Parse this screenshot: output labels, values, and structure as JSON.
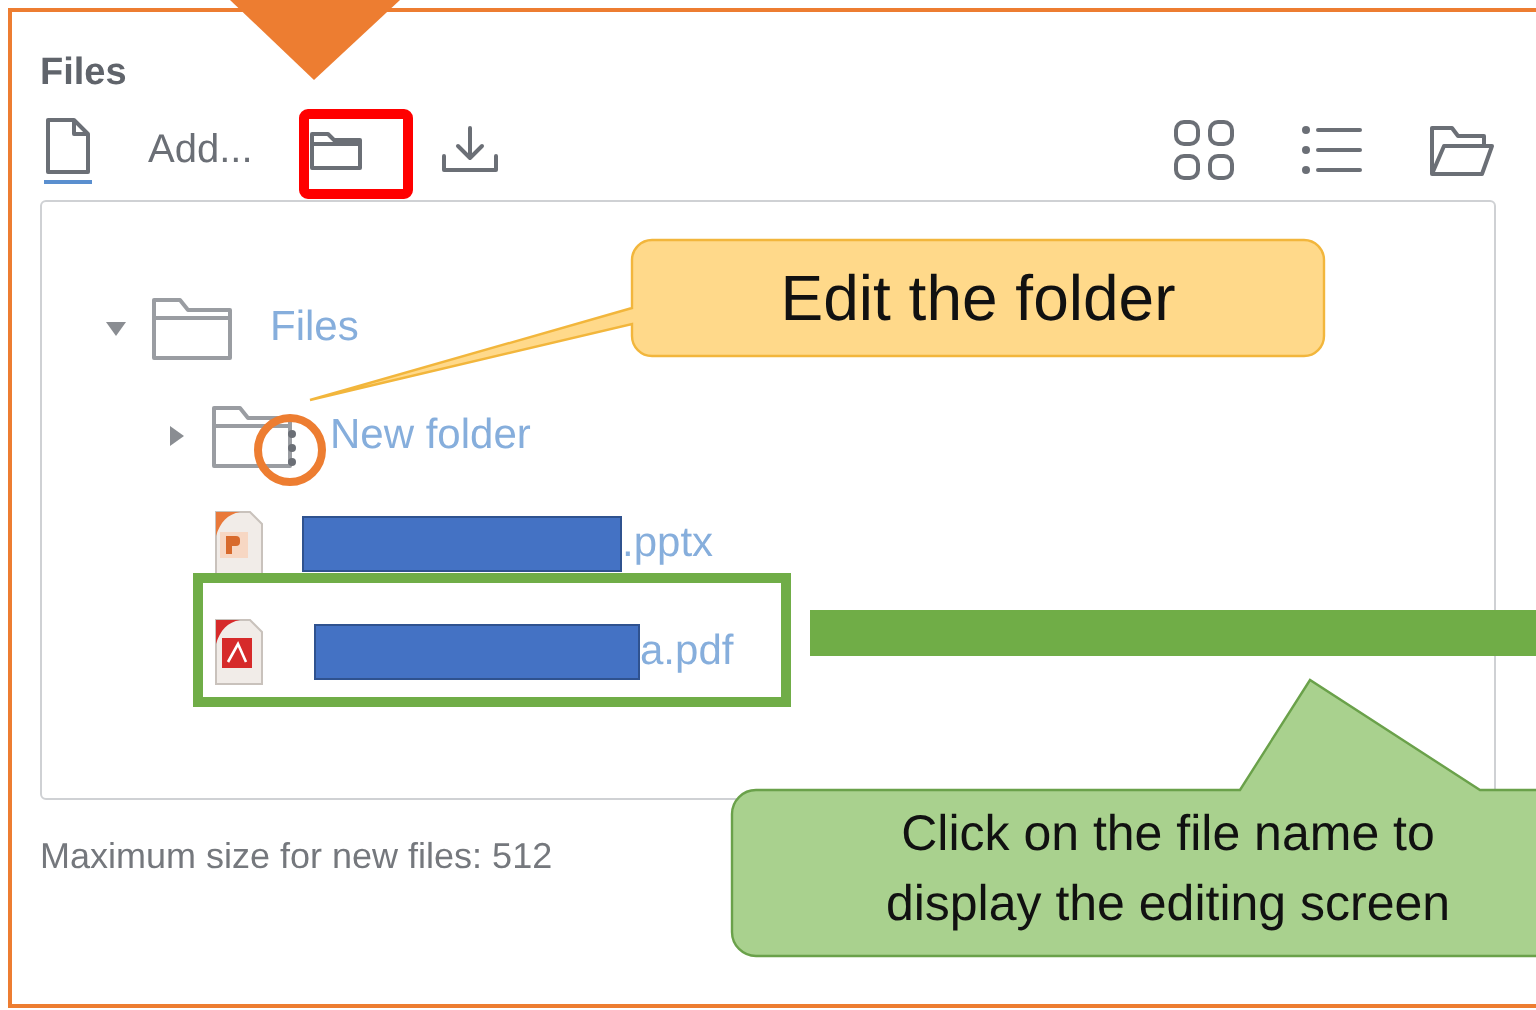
{
  "panel": {
    "title": "Files"
  },
  "toolbar": [
    {
      "kind": "add-file",
      "label": "Add...",
      "selected": true
    },
    {
      "kind": "new-folder",
      "selected": false
    },
    {
      "kind": "download",
      "selected": false
    }
  ],
  "view_buttons": [
    {
      "kind": "grid"
    },
    {
      "kind": "list"
    },
    {
      "kind": "folder"
    }
  ],
  "tree": [
    {
      "kind": "folder",
      "name": "Files",
      "expanded": true,
      "children": [
        {
          "kind": "folder",
          "name": "New folder",
          "expanded": false
        },
        {
          "kind": "pptx",
          "name": ".pptx",
          "redacted": true
        },
        {
          "kind": "pdf",
          "name": "a.pdf",
          "redacted": true
        }
      ]
    }
  ],
  "footer": "Maximum size for new files: 512",
  "annotations": [
    {
      "text": "Edit the folder",
      "color": "#ffd98a"
    },
    {
      "text": "Click on the file name to\ndisplay the editing screen",
      "color": "#a9d18e"
    }
  ]
}
